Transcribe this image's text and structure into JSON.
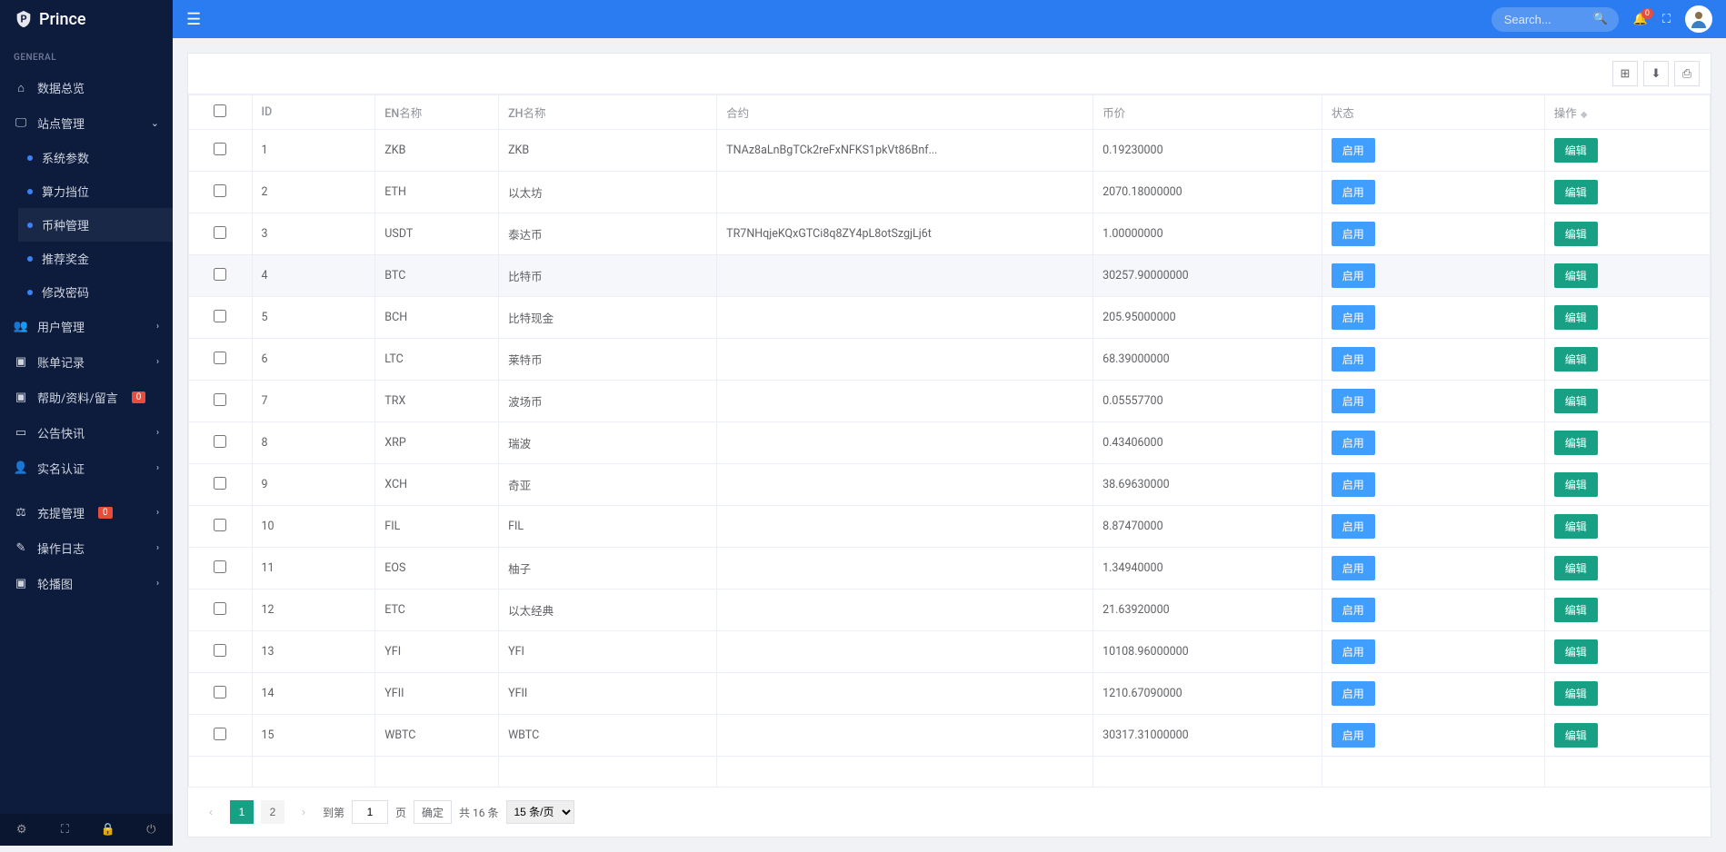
{
  "brand": "Prince",
  "nav": {
    "section": "GENERAL",
    "overview": "数据总览",
    "site_mgmt": "站点管理",
    "site_sub": {
      "sys_params": "系统参数",
      "power_level": "算力挡位",
      "coin_mgmt": "币种管理",
      "referral": "推荐奖金",
      "change_pwd": "修改密码"
    },
    "user_mgmt": "用户管理",
    "bill_record": "账单记录",
    "help_msg": "帮助/资料/留言",
    "help_badge": "0",
    "announce": "公告快讯",
    "realname": "实名认证",
    "withdraw": "充提管理",
    "withdraw_badge": "0",
    "op_log": "操作日志",
    "carousel": "轮播图"
  },
  "topbar": {
    "search_placeholder": "Search...",
    "notif_count": "0"
  },
  "table": {
    "headers": {
      "id": "ID",
      "en": "EN名称",
      "zh": "ZH名称",
      "contract": "合约",
      "price": "币价",
      "status": "状态",
      "action": "操作"
    },
    "status_btn": "启用",
    "action_btn": "编辑",
    "rows": [
      {
        "id": "1",
        "en": "ZKB",
        "zh": "ZKB",
        "contract": "TNAz8aLnBgTCk2reFxNFKS1pkVt86Bnf...",
        "price": "0.19230000"
      },
      {
        "id": "2",
        "en": "ETH",
        "zh": "以太坊",
        "contract": "",
        "price": "2070.18000000"
      },
      {
        "id": "3",
        "en": "USDT",
        "zh": "泰达币",
        "contract": "TR7NHqjeKQxGTCi8q8ZY4pL8otSzgjLj6t",
        "price": "1.00000000"
      },
      {
        "id": "4",
        "en": "BTC",
        "zh": "比特币",
        "contract": "",
        "price": "30257.90000000"
      },
      {
        "id": "5",
        "en": "BCH",
        "zh": "比特现金",
        "contract": "",
        "price": "205.95000000"
      },
      {
        "id": "6",
        "en": "LTC",
        "zh": "莱特币",
        "contract": "",
        "price": "68.39000000"
      },
      {
        "id": "7",
        "en": "TRX",
        "zh": "波场币",
        "contract": "",
        "price": "0.05557700"
      },
      {
        "id": "8",
        "en": "XRP",
        "zh": "瑞波",
        "contract": "",
        "price": "0.43406000"
      },
      {
        "id": "9",
        "en": "XCH",
        "zh": "奇亚",
        "contract": "",
        "price": "38.69630000"
      },
      {
        "id": "10",
        "en": "FIL",
        "zh": "FIL",
        "contract": "",
        "price": "8.87470000"
      },
      {
        "id": "11",
        "en": "EOS",
        "zh": "柚子",
        "contract": "",
        "price": "1.34940000"
      },
      {
        "id": "12",
        "en": "ETC",
        "zh": "以太经典",
        "contract": "",
        "price": "21.63920000"
      },
      {
        "id": "13",
        "en": "YFI",
        "zh": "YFI",
        "contract": "",
        "price": "10108.96000000"
      },
      {
        "id": "14",
        "en": "YFII",
        "zh": "YFII",
        "contract": "",
        "price": "1210.67090000"
      },
      {
        "id": "15",
        "en": "WBTC",
        "zh": "WBTC",
        "contract": "",
        "price": "30317.31000000"
      }
    ]
  },
  "pagination": {
    "pages": [
      "1",
      "2"
    ],
    "goto_label": "到第",
    "goto_value": "1",
    "page_label": "页",
    "confirm": "确定",
    "total": "共 16 条",
    "per_page": "15 条/页"
  }
}
